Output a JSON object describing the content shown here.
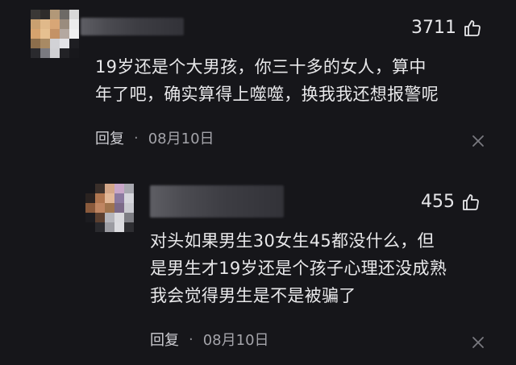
{
  "comments": [
    {
      "likes": "3711",
      "text_lines": [
        "19岁还是个大男孩，你三十多的女人，算中",
        "年了吧，确实算得上噬噬，换我我还想报警呢"
      ],
      "reply_label": "回复",
      "separator": "·",
      "date": "08月10日"
    },
    {
      "likes": "455",
      "text_lines": [
        "对头如果男生30女生45都没什么，但",
        "是男生才19岁还是个孩子心理还没成熟",
        "我会觉得男生是不是被骗了"
      ],
      "reply_label": "回复",
      "separator": "·",
      "date": "08月10日"
    }
  ],
  "icons": {
    "like": "thumbs-up-icon",
    "close": "close-icon"
  },
  "colors": {
    "background": "#16161a",
    "text": "#e8e8ea",
    "meta": "#a4a4aa"
  }
}
